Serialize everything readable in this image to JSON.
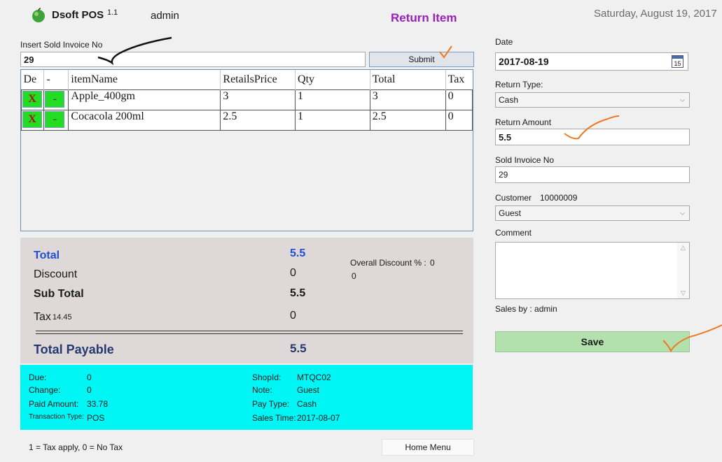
{
  "header": {
    "app_name": "Dsoft POS",
    "version": "1.1",
    "user": "admin",
    "screen_title": "Return Item",
    "date": "Saturday,  August 19,  2017"
  },
  "invoice_search": {
    "label": "Insert Sold Invoice No",
    "value": "29",
    "submit_label": "Submit"
  },
  "grid": {
    "columns": [
      "De",
      "-",
      "itemName",
      "RetailsPrice",
      "Qty",
      "Total",
      "Tax"
    ],
    "rows": [
      {
        "delete": "X",
        "minus": "-",
        "itemName": "Apple_400gm",
        "price": "3",
        "qty": "1",
        "total": "3",
        "tax": "0"
      },
      {
        "delete": "X",
        "minus": "-",
        "itemName": "Cocacola 200ml",
        "price": "2.5",
        "qty": "1",
        "total": "2.5",
        "tax": "0"
      }
    ]
  },
  "totals": {
    "total_label": "Total",
    "total_value": "5.5",
    "discount_label": "Discount",
    "discount_value": "0",
    "subtotal_label": "Sub Total",
    "subtotal_value": "5.5",
    "tax_label": "Tax",
    "tax_rate": "14.45",
    "tax_value": "0",
    "payable_label": "Total Payable",
    "payable_value": "5.5",
    "overall_discount_label": "Overall Discount % :",
    "overall_discount_value": "0",
    "overall_discount_amount": "0"
  },
  "info": {
    "due_label": "Due:",
    "due": "0",
    "change_label": "Change:",
    "change": "0",
    "paid_label": "Paid Amount:",
    "paid": "33.78",
    "txn_label": "Transaction Type:",
    "txn": "POS",
    "shop_label": "ShopId:",
    "shop": "MTQC02",
    "note_label": "Note:",
    "note": "Guest",
    "paytype_label": "Pay Type:",
    "paytype": "Cash",
    "salestime_label": "Sales Time:",
    "salestime": "2017-08-07"
  },
  "footer": {
    "tax_note": "1 = Tax apply, 0 = No Tax",
    "home_label": "Home Menu"
  },
  "form": {
    "date_label": "Date",
    "date_value": "2017-08-19",
    "calendar_day": "15",
    "return_type_label": "Return Type:",
    "return_type": "Cash",
    "return_amount_label": "Return Amount",
    "return_amount": "5.5",
    "sold_invoice_label": "Sold Invoice No",
    "sold_invoice": "29",
    "customer_label": "Customer",
    "customer_id": "10000009",
    "customer": "Guest",
    "comment_label": "Comment",
    "comment": "",
    "sales_by": "Sales by : admin",
    "save_label": "Save"
  },
  "colors": {
    "title": "#9a1fb8",
    "total_blue": "#1f4fcf",
    "payable_navy": "#243a6e",
    "info_bg": "#00f5f5",
    "save_bg": "#b2e1ad",
    "action_green": "#22dd22",
    "annotation_orange": "#f07820"
  },
  "icons": [
    "apple-logo-icon",
    "calendar-icon",
    "chevron-down-icon"
  ]
}
